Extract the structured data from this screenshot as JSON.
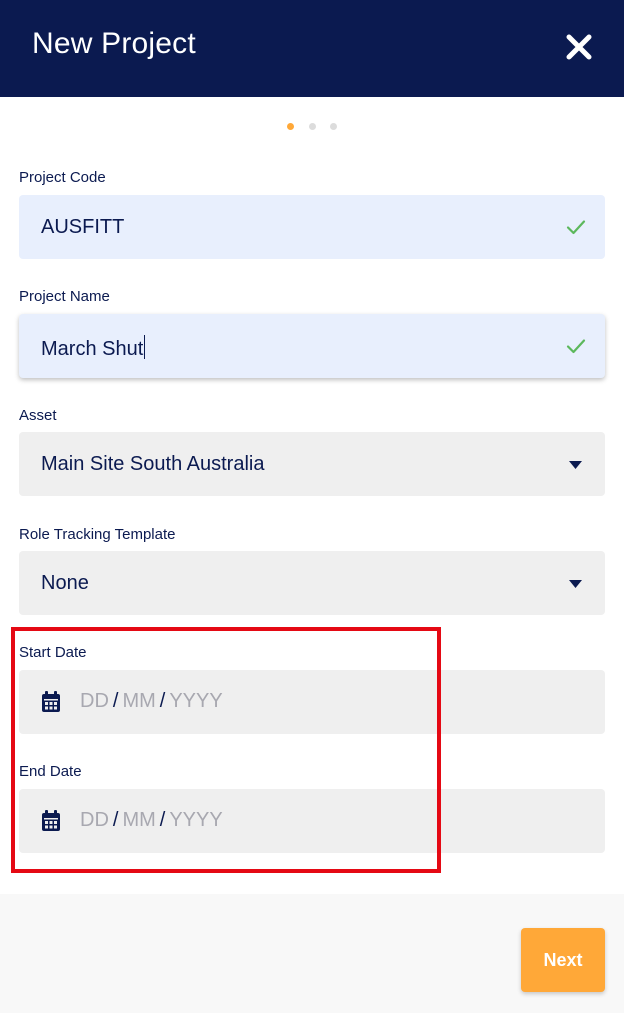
{
  "header": {
    "title": "New Project",
    "close_icon": "close-icon"
  },
  "steps": {
    "total": 3,
    "current": 1,
    "active_color": "#ffa838",
    "inactive_color": "#dcdcdc"
  },
  "fields": {
    "project_code": {
      "label": "Project Code",
      "value": "AUSFITT",
      "valid": true
    },
    "project_name": {
      "label": "Project Name",
      "value": "March Shut",
      "valid": true
    },
    "asset": {
      "label": "Asset",
      "value": "Main Site South Australia"
    },
    "role_template": {
      "label": "Role Tracking Template",
      "value": "None"
    },
    "start_date": {
      "label": "Start Date",
      "day": "DD",
      "month": "MM",
      "year": "YYYY",
      "separator": "/"
    },
    "end_date": {
      "label": "End Date",
      "day": "DD",
      "month": "MM",
      "year": "YYYY",
      "separator": "/"
    }
  },
  "footer": {
    "next_label": "Next"
  },
  "colors": {
    "header_bg": "#0b1a50",
    "accent": "#ffa838",
    "valid_check": "#5cb85c",
    "highlight": "#e50914"
  }
}
